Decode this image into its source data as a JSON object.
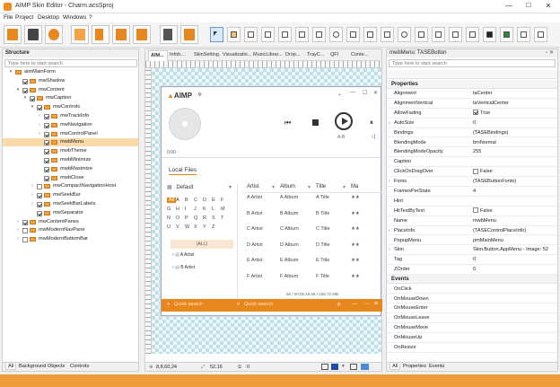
{
  "window": {
    "title": "AIMP Skin Editor - Charm.acsSproj",
    "min": "—",
    "max": "☐",
    "close": "✕"
  },
  "menu": [
    "File",
    "Project",
    "Desktop",
    "Windows",
    "?"
  ],
  "structure": {
    "title": "Structure",
    "search_placeholder": "Type here to start search",
    "items": [
      {
        "label": "aimMainForm",
        "exp": "▾",
        "level": 0,
        "cb": false
      },
      {
        "label": "mwShadow",
        "exp": "",
        "level": 1,
        "cb": true
      },
      {
        "label": "mwContent",
        "exp": "▾",
        "level": 1,
        "cb": true
      },
      {
        "label": "mwCaption",
        "exp": "▾",
        "level": 2,
        "cb": true
      },
      {
        "label": "mwControls",
        "exp": "▾",
        "level": 3,
        "cb": true
      },
      {
        "label": "mwTrackInfo",
        "exp": "›",
        "level": 4,
        "cb": true
      },
      {
        "label": "mwNavigation",
        "exp": "›",
        "level": 4,
        "cb": true
      },
      {
        "label": "mwControlPanel",
        "exp": "›",
        "level": 4,
        "cb": true
      },
      {
        "label": "mwbMenu",
        "exp": "",
        "level": 4,
        "cb": true,
        "sel": true
      },
      {
        "label": "mwbTheme",
        "exp": "",
        "level": 4,
        "cb": true
      },
      {
        "label": "mwbMinimize",
        "exp": "",
        "level": 4,
        "cb": true
      },
      {
        "label": "mwbMaximize",
        "exp": "",
        "level": 4,
        "cb": true
      },
      {
        "label": "mwbClose",
        "exp": "",
        "level": 4,
        "cb": true
      },
      {
        "label": "mwCompactNavigationHost",
        "exp": "›",
        "level": 3,
        "cb": false
      },
      {
        "label": "mwSeekBar",
        "exp": "›",
        "level": 3,
        "cb": true
      },
      {
        "label": "mwSeekBarLabels",
        "exp": "›",
        "level": 3,
        "cb": true
      },
      {
        "label": "mwSeparator",
        "exp": "",
        "level": 3,
        "cb": true
      },
      {
        "label": "mwContentPanes",
        "exp": "›",
        "level": 1,
        "cb": true
      },
      {
        "label": "mwModernNavPane",
        "exp": "›",
        "level": 1,
        "cb": false
      },
      {
        "label": "mwModernBottomBar",
        "exp": "›",
        "level": 1,
        "cb": false
      }
    ],
    "tabs": [
      "All",
      "Background Objects",
      "Controls"
    ]
  },
  "doctabs": [
    "AIM...",
    "Infob...",
    "SkinSetting...",
    "Visualizatio...",
    "MusicLibrar...",
    "Drop...",
    "TrayC...",
    "QFI",
    "Conte..."
  ],
  "player": {
    "brand": "AIMP",
    "time": "0:00",
    "ab": "A-B",
    "local_files": "Local Files",
    "default_label": "Default",
    "letters": [
      "All",
      "A",
      "B",
      "C",
      "D",
      "E",
      "F",
      "G",
      "H",
      "I",
      "J",
      "K",
      "L",
      "M",
      "N",
      "O",
      "P",
      "Q",
      "R",
      "S",
      "T",
      "U",
      "V",
      "W",
      "X",
      "Y",
      "Z"
    ],
    "all_label": "(ALL)",
    "tree": [
      "A Artist",
      "B Artist"
    ],
    "columns": [
      "Artist",
      "Album",
      "Title",
      "Ma"
    ],
    "rows": [
      [
        "A Artist",
        "A Album",
        "A Title"
      ],
      [
        "B Artist",
        "B Album",
        "B Title"
      ],
      [
        "C Artist",
        "C Album",
        "C Title"
      ],
      [
        "D Artist",
        "D Album",
        "D Title"
      ],
      [
        "E Artist",
        "E Album",
        "E Title"
      ],
      [
        "F Artist",
        "F Album",
        "F Title"
      ]
    ],
    "stars": "★★",
    "summary": "56 / 00:05:16,06 / 165.72 MB",
    "quick1": "Quick search",
    "quick2": "Quick search",
    "plus": "+",
    "minus": "—",
    "dots": "···",
    "menu": "≡"
  },
  "status": {
    "coords": "8,8,60,24",
    "size": "52,16",
    "count": "0"
  },
  "props": {
    "title": "mwbMenu: TASEButton",
    "search_placeholder": "Type here to start search",
    "section1": "Properties",
    "section2": "Events",
    "rows": [
      {
        "name": "Alignment",
        "value": "taCenter"
      },
      {
        "name": "AlignmentVertical",
        "value": "taVerticalCenter"
      },
      {
        "name": "AllowFading",
        "value": "True",
        "cb": true
      },
      {
        "name": "AutoSize",
        "value": "0",
        "exp": "›"
      },
      {
        "name": "Bindings",
        "value": "(TASEBindings)"
      },
      {
        "name": "BlendingMode",
        "value": "bmNormal"
      },
      {
        "name": "BlendingModeOpacity",
        "value": "255"
      },
      {
        "name": "Caption",
        "value": ""
      },
      {
        "name": "ClickOnDragOver",
        "value": "False",
        "cb": false
      },
      {
        "name": "Fonts",
        "value": "(TASEButtonFonts)",
        "exp": "›"
      },
      {
        "name": "FramesPerState",
        "value": "4"
      },
      {
        "name": "Hint",
        "value": ""
      },
      {
        "name": "HitTestByText",
        "value": "False",
        "cb": false
      },
      {
        "name": "Name",
        "value": "mwbMenu"
      },
      {
        "name": "PlaceInfo",
        "value": "(TASEControlPlaceInfo)",
        "exp": "›"
      },
      {
        "name": "PopupMenu",
        "value": "pmMainMenu"
      },
      {
        "name": "Skin",
        "value": "Skin.Button.AppMenu - Image: 52",
        "exp": "›"
      },
      {
        "name": "Tag",
        "value": "0"
      },
      {
        "name": "ZOrder",
        "value": "0"
      }
    ],
    "events": [
      "OnClick",
      "OnMouseDown",
      "OnMouseEnter",
      "OnMouseLeave",
      "OnMouseMove",
      "OnMouseUp",
      "OnResize"
    ],
    "tabs": [
      "All",
      "Properties",
      "Events"
    ]
  },
  "colors": {
    "accent": "#e8871e",
    "selection": "#fcd9a8"
  }
}
